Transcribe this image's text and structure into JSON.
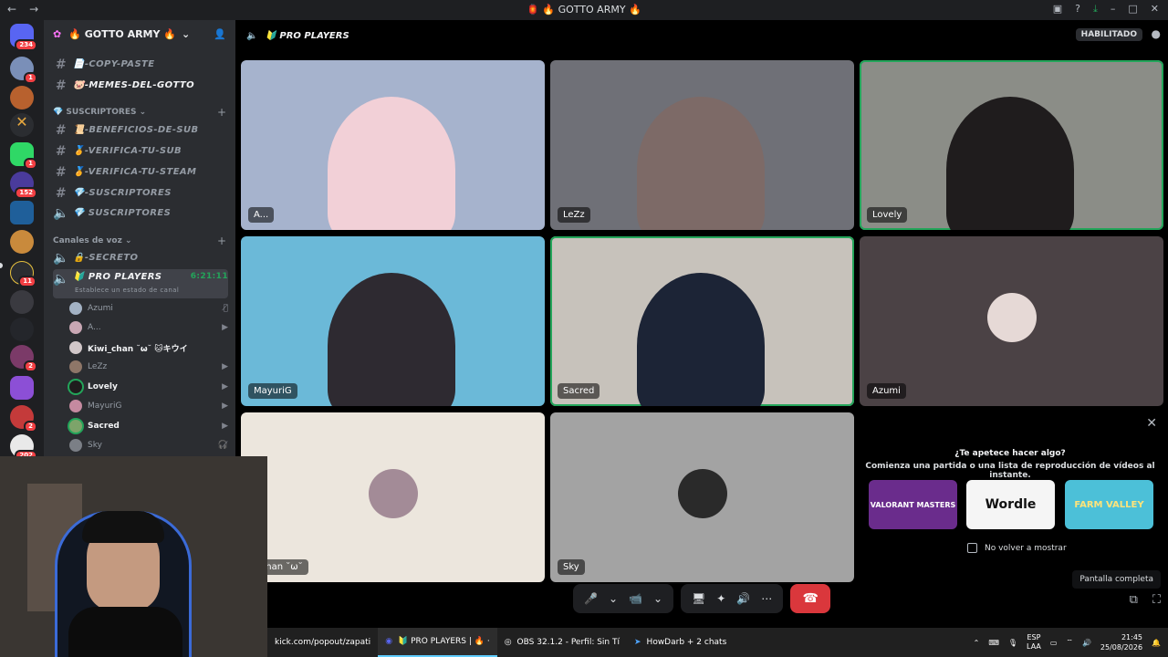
{
  "window": {
    "title": "🏮 🔥 GOTTO ARMY 🔥",
    "back": "←",
    "forward": "→"
  },
  "guilds": {
    "home_badge": "234",
    "badges": [
      "1",
      "",
      "",
      "1",
      "152",
      "",
      "",
      "",
      "11",
      "",
      "",
      "2",
      "",
      "",
      "2",
      "202"
    ]
  },
  "server": {
    "name": "🔥 GOTTO ARMY 🔥"
  },
  "channels": {
    "text": [
      {
        "label": "📄-COPY-PASTE"
      },
      {
        "label": "🐷-MEMES-DEL-GOTTO"
      }
    ],
    "subs_category": "SUSCRIPTORES",
    "subs": [
      {
        "label": "📜-BENEFICIOS-DE-SUB"
      },
      {
        "label": "🏅-VERIFICA-TU-SUB"
      },
      {
        "label": "🏅-VERIFICA-TU-STEAM"
      },
      {
        "label": "💎-SUSCRIPTORES"
      },
      {
        "label": "💎 SUSCRIPTORES"
      }
    ],
    "voice_category": "Canales de voz",
    "voice": [
      {
        "label": "🔒-SECRETO"
      },
      {
        "label": "🔰 PRO PLAYERS",
        "time": "6:21:11",
        "status": "Establece un estado de canal"
      }
    ]
  },
  "members": [
    {
      "name": "Azumi",
      "color": "#a3b2c4"
    },
    {
      "name": "A...",
      "color": "#c9a7b4"
    },
    {
      "name": "Kiwi_chan ˘ω˘ 🐱キウイ",
      "color": "#d1c7c9"
    },
    {
      "name": "LeZz",
      "color": "#8e7668"
    },
    {
      "name": "Lovely",
      "color": "#f1c40f"
    },
    {
      "name": "MayuriG",
      "color": "#c58aa0"
    },
    {
      "name": "Sacred",
      "color": "#7da46a"
    },
    {
      "name": "Sky",
      "color": "#7b7f86"
    }
  ],
  "stage": {
    "channel": "🔰 PRO PLAYERS",
    "habilitado": "HABILITADO",
    "tiles": [
      {
        "name": "A...",
        "bg": "#a6b3cd",
        "person": "#f2d0d7",
        "speaking": false
      },
      {
        "name": "LeZz",
        "bg": "#6f7077",
        "person": "#7d6a67",
        "speaking": false
      },
      {
        "name": "Lovely",
        "bg": "#8b8d87",
        "person": "#1f1c1d",
        "speaking": true
      },
      {
        "name": "MayuriG",
        "bg": "#6bb9d8",
        "person": "#2e2a31",
        "speaking": false
      },
      {
        "name": "Sacred",
        "bg": "#c7c2bb",
        "person": "#1c2436",
        "speaking": true
      },
      {
        "name": "Azumi",
        "bg": "#4b4245",
        "person": "#e6d9d6",
        "speaking": false
      },
      {
        "name": "i_chan ˘ω˘",
        "bg": "#ece6dd",
        "person": "#a38b97",
        "speaking": false
      },
      {
        "name": "Sky",
        "bg": "#a3a3a3",
        "person": "#2a2a2a",
        "speaking": false
      }
    ]
  },
  "popup": {
    "question": "¿Te apetece hacer algo?",
    "desc": "Comienza una partida o una lista de reproducción de vídeos al instante.",
    "activities": [
      {
        "name": "VALORANT MASTERS",
        "bg": "#6a2c8c",
        "fg": "#ffffff"
      },
      {
        "name": "Wordle",
        "bg": "#f5f5f5",
        "fg": "#111111"
      },
      {
        "name": "FARM VALLEY",
        "bg": "#4cc0d8",
        "fg": "#ffe37a"
      }
    ],
    "checkbox_label": "No volver a mostrar"
  },
  "tooltip": "Pantalla completa",
  "controls": {
    "mic": "🎤",
    "cam": "📹",
    "share": "🖥",
    "activities": "✦",
    "soundboard": "🔊",
    "more": "⋯",
    "end": "☎"
  },
  "taskbar": {
    "items": [
      {
        "label": "kick.com/popout/zapati",
        "icon": ""
      },
      {
        "label": "🔰 PRO PLAYERS | 🔥 ·",
        "icon": "◉"
      },
      {
        "label": "OBS 32.1.2 - Perfil: Sin Tí",
        "icon": "◎"
      },
      {
        "label": "HowDarb + 2 chats",
        "icon": "➤"
      }
    ],
    "lang": "ESP",
    "lang2": "LAA",
    "time": "21:45",
    "date": "25/08/2026"
  }
}
